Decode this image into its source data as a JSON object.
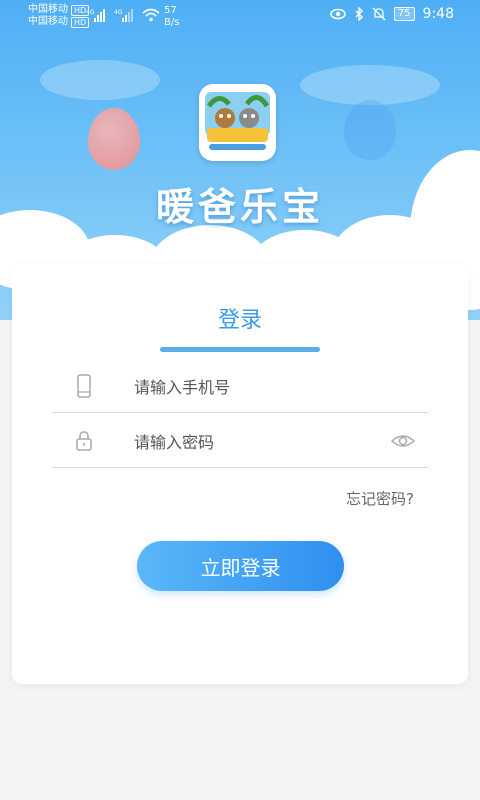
{
  "status_bar": {
    "carrier_1": "中国移动",
    "carrier_2": "中国移动",
    "hd_badge": "HD",
    "network_1": "4G",
    "network_2": "4G",
    "speed_value": "57",
    "speed_unit": "B/s",
    "battery": "75",
    "time": "9:48"
  },
  "app": {
    "brand_name": "暖爸乐宝",
    "logo_icon": "app-logo"
  },
  "login_form": {
    "tab_title": "登录",
    "phone_placeholder": "请输入手机号",
    "password_placeholder": "请输入密码",
    "forgot_password": "忘记密码?",
    "submit_label": "立即登录"
  },
  "colors": {
    "accent": "#3a9ce8",
    "button_start": "#5ab8f8",
    "button_end": "#2f8ff0",
    "hero_top": "#4faff5"
  }
}
